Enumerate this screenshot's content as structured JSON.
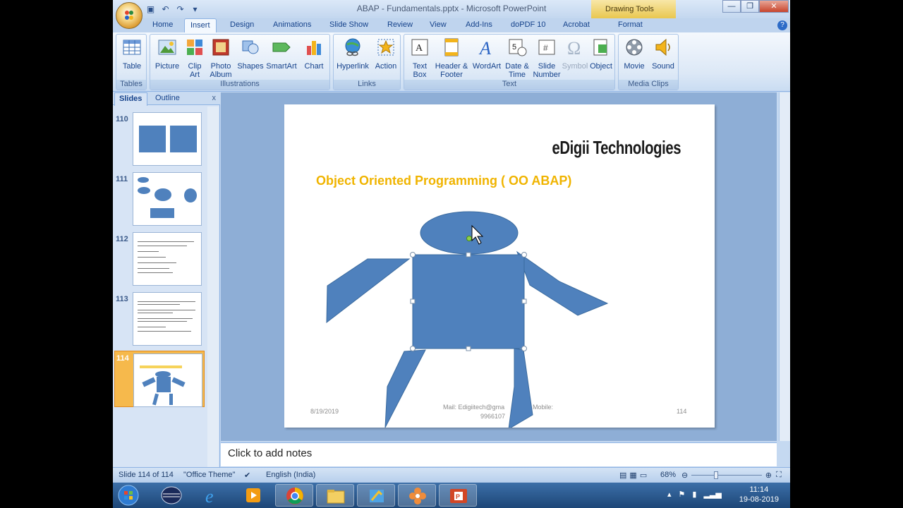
{
  "window": {
    "title": "ABAP - Fundamentals.pptx - Microsoft PowerPoint",
    "context_tab": "Drawing Tools",
    "controls": [
      "minimize",
      "restore",
      "close"
    ]
  },
  "tabs": [
    "Home",
    "Insert",
    "Design",
    "Animations",
    "Slide Show",
    "Review",
    "View",
    "Add-Ins",
    "doPDF 10",
    "Acrobat",
    "Format"
  ],
  "active_tab": "Insert",
  "ribbon": {
    "groups": [
      {
        "label": "Tables",
        "buttons": [
          {
            "label": "Table",
            "icon": "table-icon"
          }
        ]
      },
      {
        "label": "Illustrations",
        "buttons": [
          {
            "label": "Picture",
            "icon": "picture-icon"
          },
          {
            "label": "Clip Art",
            "icon": "clip-art-icon"
          },
          {
            "label": "Photo Album",
            "icon": "photo-album-icon"
          },
          {
            "label": "Shapes",
            "icon": "shapes-icon"
          },
          {
            "label": "SmartArt",
            "icon": "smartart-icon"
          },
          {
            "label": "Chart",
            "icon": "chart-icon"
          }
        ]
      },
      {
        "label": "Links",
        "buttons": [
          {
            "label": "Hyperlink",
            "icon": "hyperlink-icon"
          },
          {
            "label": "Action",
            "icon": "action-icon"
          }
        ]
      },
      {
        "label": "Text",
        "buttons": [
          {
            "label": "Text Box",
            "icon": "text-box-icon"
          },
          {
            "label": "Header & Footer",
            "icon": "header-footer-icon"
          },
          {
            "label": "WordArt",
            "icon": "wordart-icon"
          },
          {
            "label": "Date & Time",
            "icon": "date-time-icon"
          },
          {
            "label": "Slide Number",
            "icon": "slide-number-icon"
          },
          {
            "label": "Symbol",
            "icon": "symbol-icon",
            "disabled": true
          },
          {
            "label": "Object",
            "icon": "object-icon"
          }
        ]
      },
      {
        "label": "Media Clips",
        "buttons": [
          {
            "label": "Movie",
            "icon": "movie-icon"
          },
          {
            "label": "Sound",
            "icon": "sound-icon"
          }
        ]
      }
    ]
  },
  "left_pane": {
    "tabs": [
      "Slides",
      "Outline"
    ],
    "active": "Slides",
    "close": "x",
    "thumbnails": [
      {
        "number": "110"
      },
      {
        "number": "111"
      },
      {
        "number": "112"
      },
      {
        "number": "113"
      },
      {
        "number": "114",
        "selected": true
      }
    ]
  },
  "slide": {
    "brand": "eDigii Technologies",
    "title": "Object Oriented Programming  ( OO ABAP)",
    "footer_date": "8/19/2019",
    "footer_center_line1": "Mail: Edigiitech@gma",
    "footer_center_line2": "Mobile:",
    "footer_center_line3": "9966107",
    "footer_page": "114"
  },
  "notes_placeholder": "Click to add notes",
  "statusbar": {
    "slide_info": "Slide 114 of 114",
    "theme": "\"Office Theme\"",
    "language": "English (India)",
    "zoom": "68%"
  },
  "taskbar": {
    "time": "11:14",
    "date": "19-08-2019",
    "apps": [
      "start-orb",
      "media-player",
      "internet-explorer",
      "video-app",
      "chrome",
      "file-explorer",
      "paint-app",
      "app-flower",
      "powerpoint"
    ]
  },
  "colors": {
    "shape_fill": "#4f81bd",
    "title_color": "#f0b400",
    "selected_thumb": "#f6b94c"
  }
}
